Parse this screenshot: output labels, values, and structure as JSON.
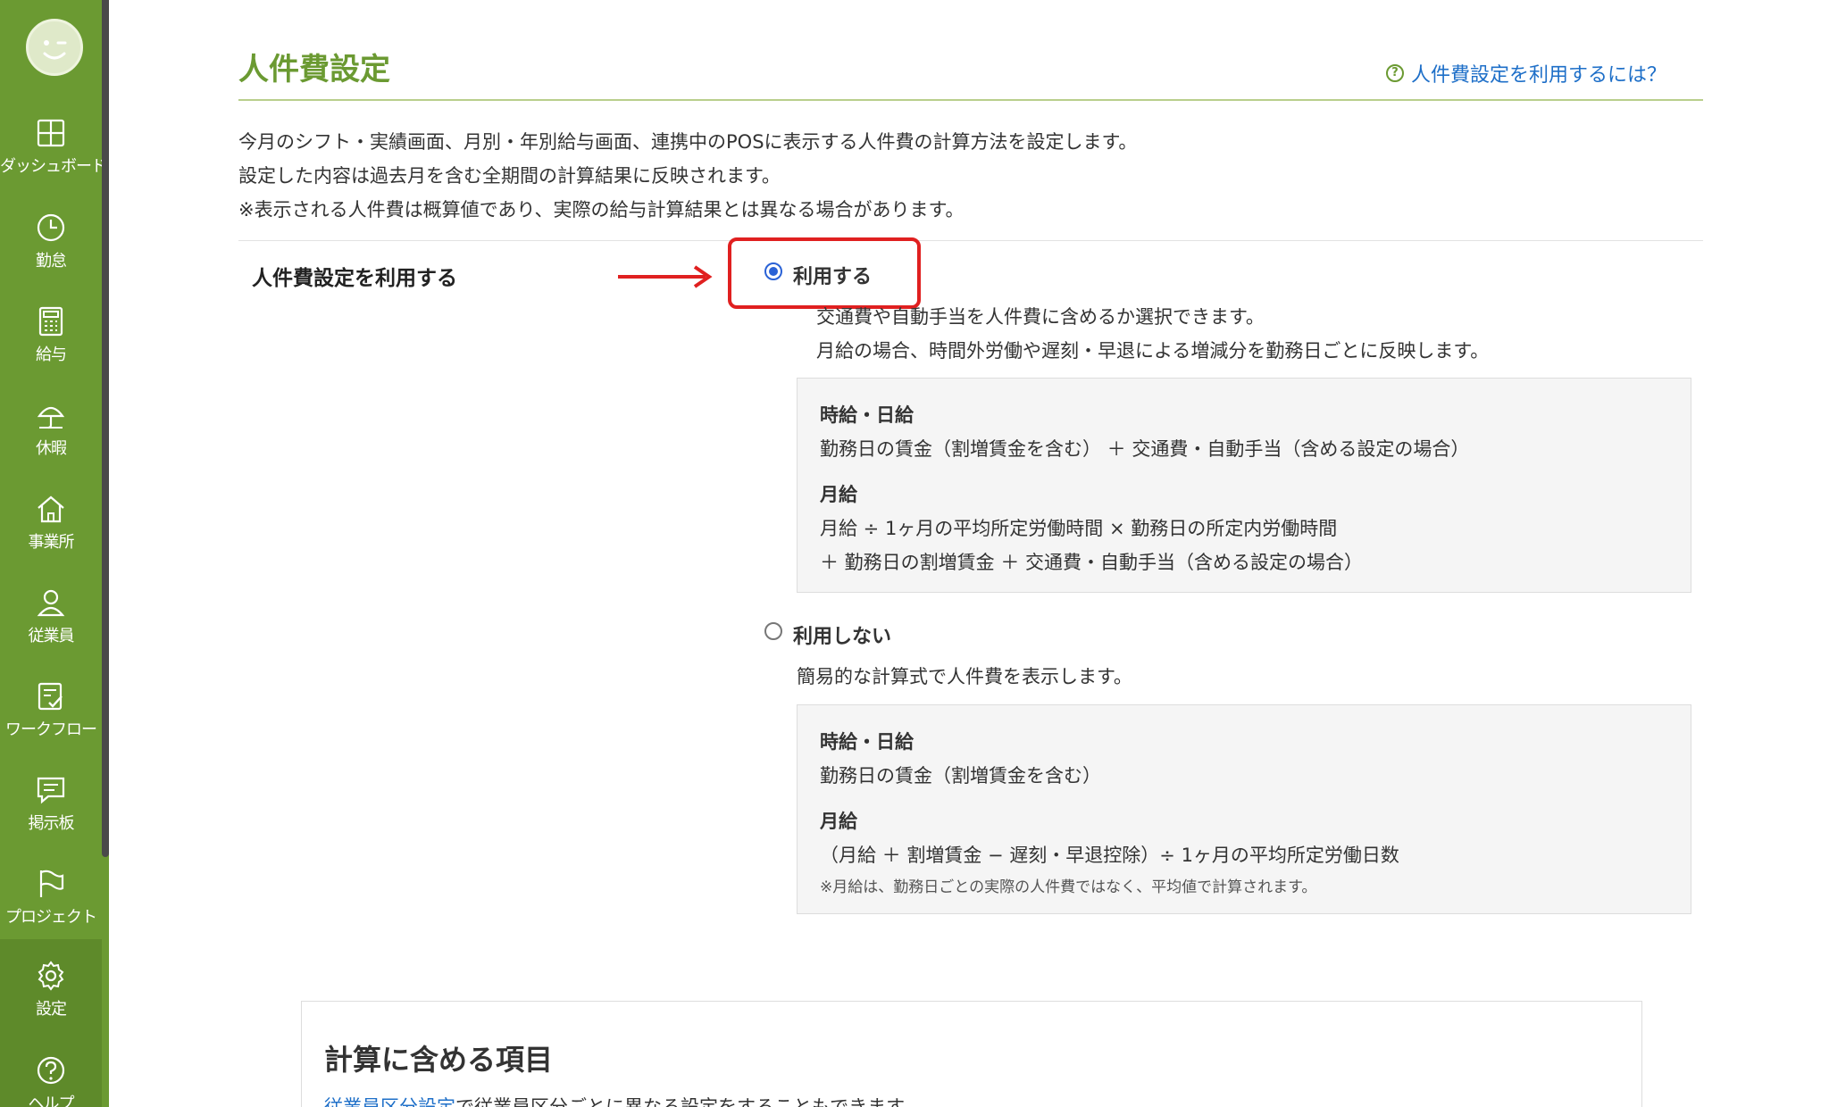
{
  "sidebar": {
    "items": [
      {
        "label": "ダッシュボード",
        "icon": "dashboard-icon"
      },
      {
        "label": "勤怠",
        "icon": "clock-icon"
      },
      {
        "label": "給与",
        "icon": "calculator-icon"
      },
      {
        "label": "休暇",
        "icon": "umbrella-icon"
      },
      {
        "label": "事業所",
        "icon": "home-icon"
      },
      {
        "label": "従業員",
        "icon": "user-icon"
      },
      {
        "label": "ワークフロー",
        "icon": "checklist-icon"
      },
      {
        "label": "掲示板",
        "icon": "message-icon"
      },
      {
        "label": "プロジェクト",
        "icon": "flag-icon"
      },
      {
        "label": "設定",
        "icon": "gear-icon"
      },
      {
        "label": "ヘルプ",
        "icon": "help-icon"
      }
    ]
  },
  "page": {
    "title": "人件費設定",
    "help_link": "人件費設定を利用するには？",
    "intro": [
      "今月のシフト・実績画面、月別・年別給与画面、連携中のPOSに表示する人件費の計算方法を設定します。",
      "設定した内容は過去月を含む全期間の計算結果に反映されます。",
      "※表示される人件費は概算値であり、実際の給与計算結果とは異なる場合があります。"
    ],
    "field_label": "人件費設定を利用する"
  },
  "option_use": {
    "label": "利用する",
    "selected": true,
    "desc": [
      "交通費や自動手当を人件費に含めるか選択できます。",
      "月給の場合、時間外労働や遅刻・早退による増減分を勤務日ごとに反映します。"
    ],
    "hourly_heading": "時給・日給",
    "hourly_formula": "勤務日の賃金（割増賃金を含む） ＋ 交通費・自動手当（含める設定の場合）",
    "monthly_heading": "月給",
    "monthly_formula_1": "月給 ÷ 1ヶ月の平均所定労働時間 × 勤務日の所定内労働時間",
    "monthly_formula_2": "＋ 勤務日の割増賃金 ＋ 交通費・自動手当（含める設定の場合）"
  },
  "option_not_use": {
    "label": "利用しない",
    "selected": false,
    "desc": "簡易的な計算式で人件費を表示します。",
    "hourly_heading": "時給・日給",
    "hourly_formula": "勤務日の賃金（割増賃金を含む）",
    "monthly_heading": "月給",
    "monthly_formula": "（月給 ＋ 割増賃金 − 遅刻・早退控除）÷ 1ヶ月の平均所定労働日数",
    "monthly_note": "※月給は、勤務日ごとの実際の人件費ではなく、平均値で計算されます。"
  },
  "calc_items": {
    "title": "計算に含める項目",
    "note_link": "従業員区分設定",
    "note_text": "で従業員区分ごとに異なる設定をすることもできます。"
  },
  "colors": {
    "sidebar": "#6b9a32",
    "title": "#6b9a32",
    "link": "#1e6fc8",
    "highlight": "#e02020",
    "radio_selected": "#2a62d6"
  }
}
